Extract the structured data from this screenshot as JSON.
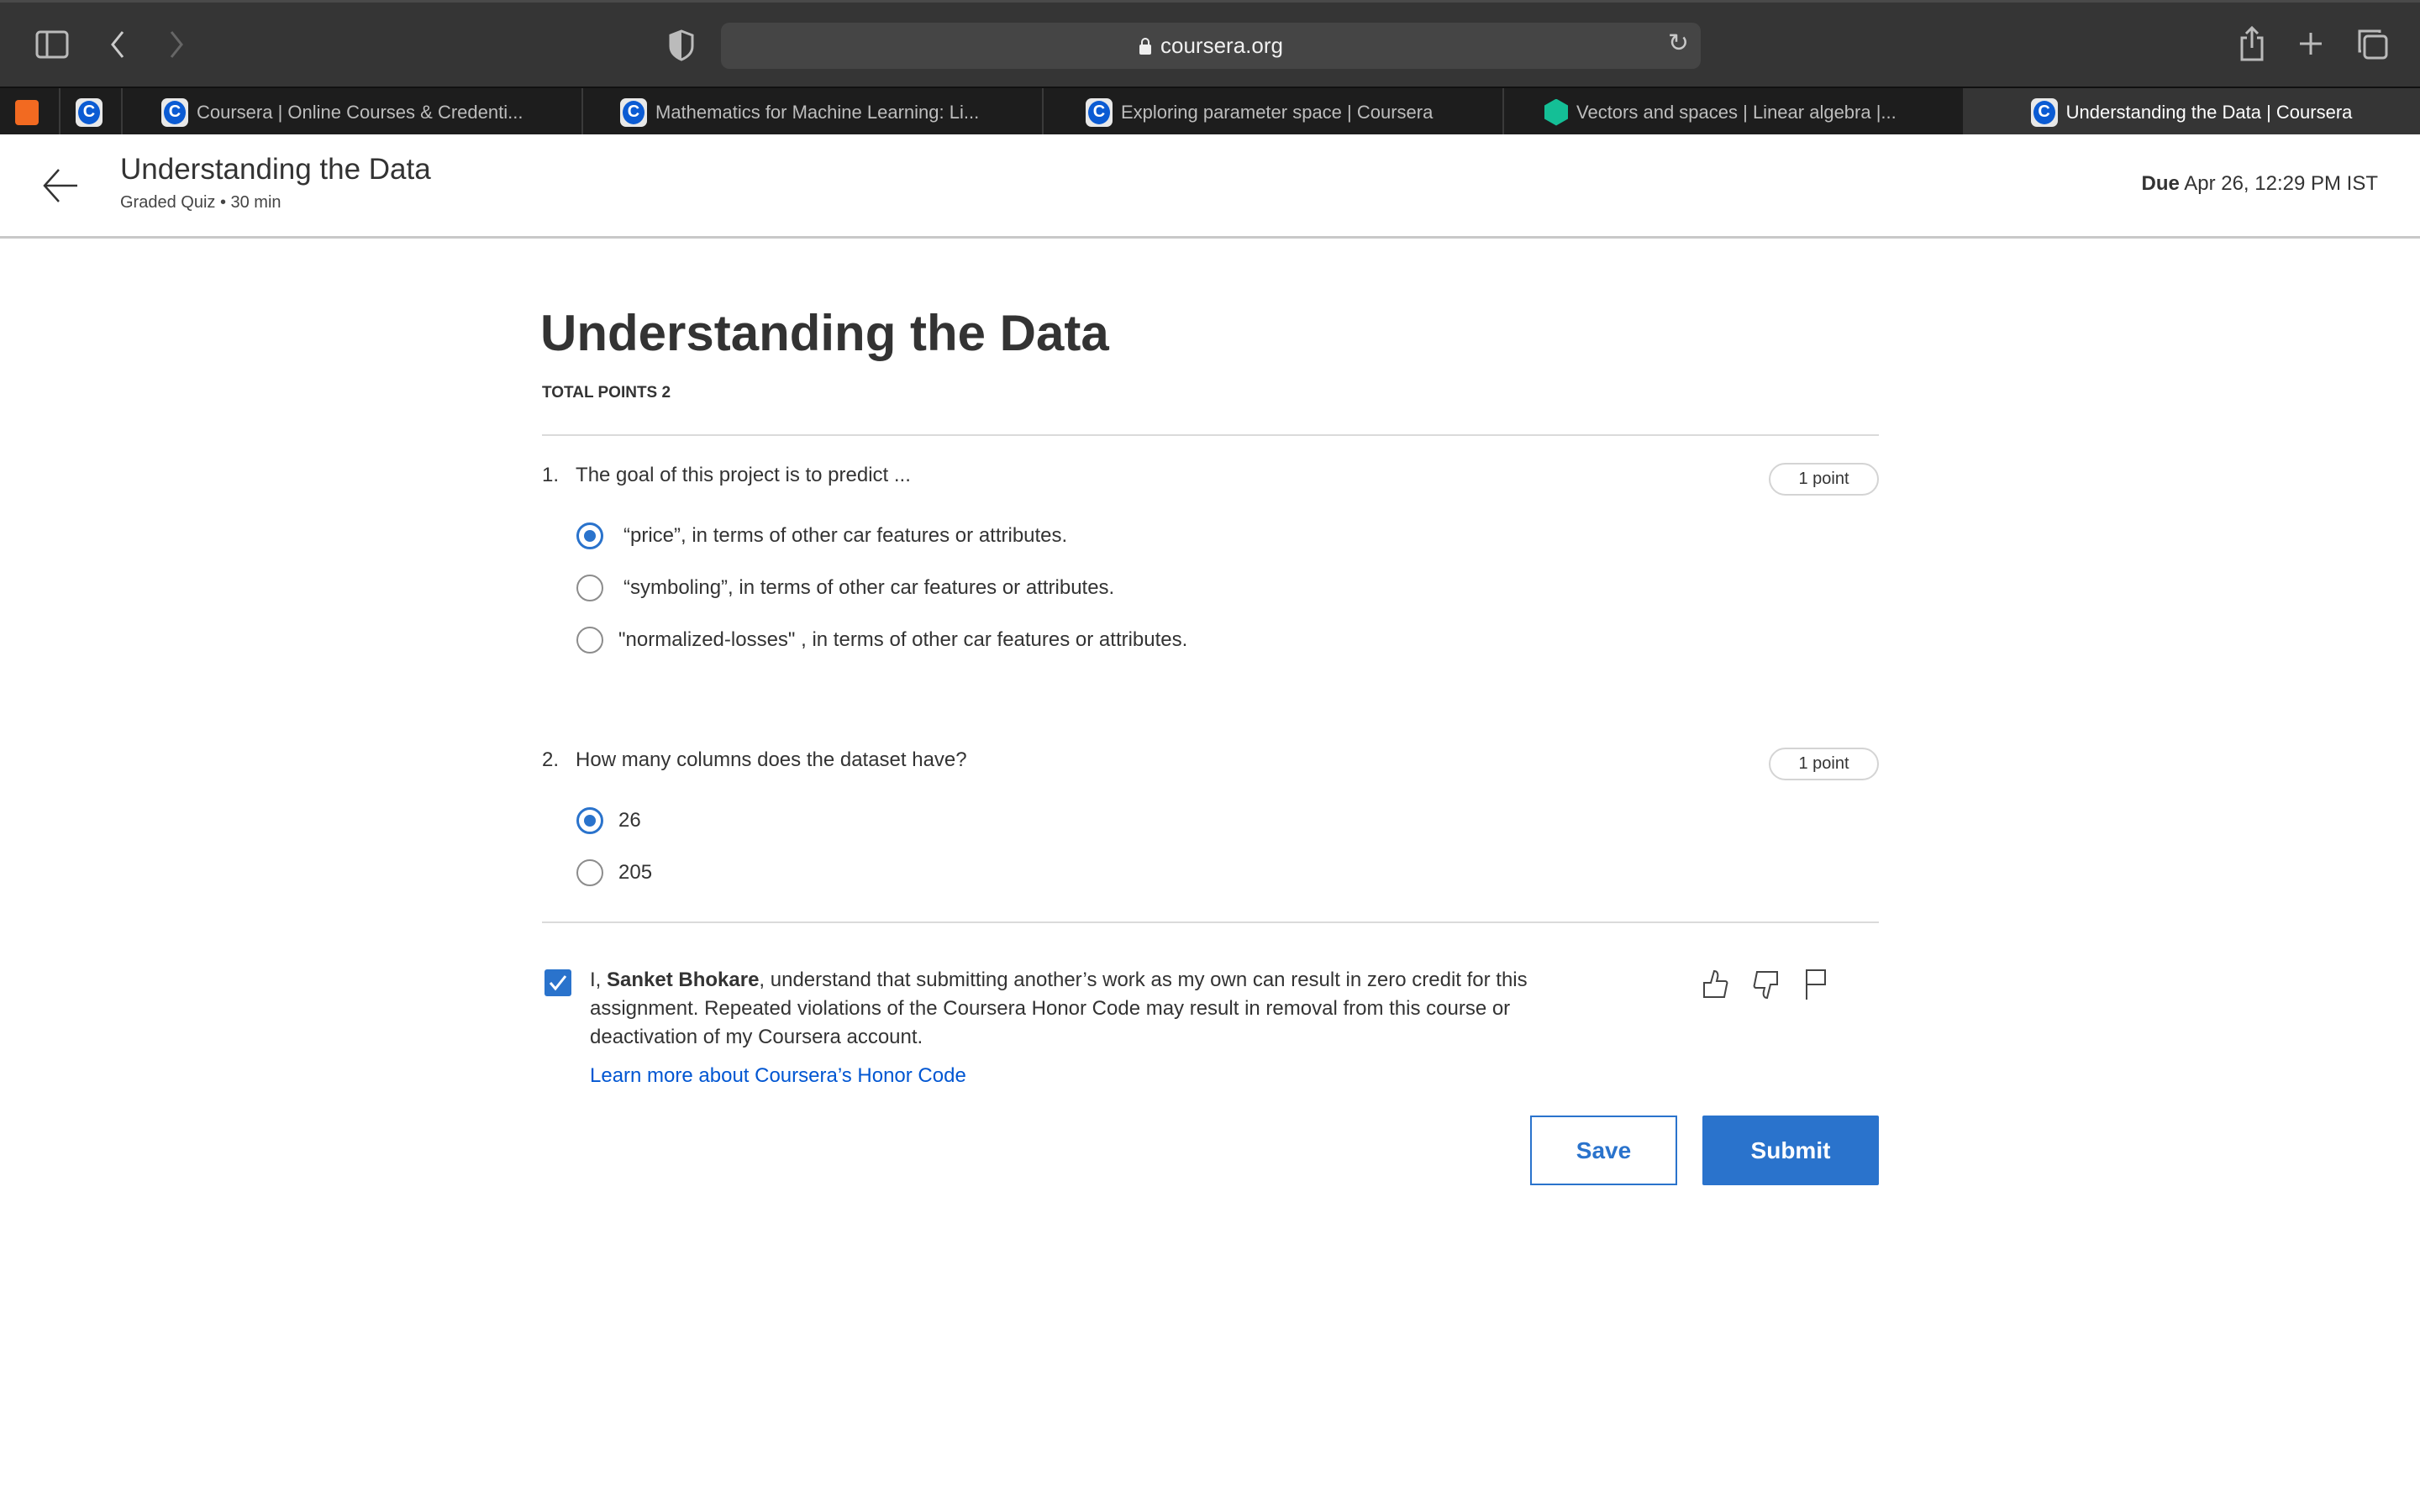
{
  "browser": {
    "url": "coursera.org",
    "tabs": [
      {
        "label": "",
        "icon": "brave-icon"
      },
      {
        "label": "",
        "icon": "coursera-icon"
      },
      {
        "label": "Coursera | Online Courses & Credenti...",
        "icon": "coursera-icon"
      },
      {
        "label": "Mathematics for Machine Learning: Li...",
        "icon": "coursera-icon"
      },
      {
        "label": "Exploring parameter space | Coursera",
        "icon": "coursera-icon"
      },
      {
        "label": "Vectors and spaces | Linear algebra |...",
        "icon": "khan-academy-icon"
      },
      {
        "label": "Understanding the Data | Coursera",
        "icon": "coursera-icon",
        "active": true
      }
    ]
  },
  "header": {
    "title": "Understanding the Data",
    "subtitle": "Graded Quiz • 30 min",
    "due_label": "Due",
    "due_value": "Apr 26, 12:29 PM IST"
  },
  "quiz": {
    "title": "Understanding the Data",
    "total_points": "TOTAL POINTS 2",
    "questions": [
      {
        "number": "1.",
        "text": "The goal of this project is to predict ...",
        "points": "1 point",
        "options": [
          {
            "label": "“price”, in terms of other car features or attributes.",
            "selected": true
          },
          {
            "label": "“symboling”, in terms of other car features or attributes.",
            "selected": false
          },
          {
            "label": "\"normalized-losses\" , in terms of other car features  or attributes.",
            "selected": false
          }
        ]
      },
      {
        "number": "2.",
        "text": "How many columns does the dataset have?",
        "points": "1 point",
        "options": [
          {
            "label": "26",
            "selected": true
          },
          {
            "label": "205",
            "selected": false
          }
        ]
      }
    ],
    "honor": {
      "checked": true,
      "prefix": "I, ",
      "name": "Sanket Bhokare",
      "text": ", understand that submitting another’s work as my own can result in zero credit for this assignment. Repeated violations of the Coursera Honor Code may result in removal from this course or deactivation of my Coursera account.",
      "link": "Learn more about Coursera’s Honor Code"
    },
    "save_label": "Save",
    "submit_label": "Submit"
  },
  "colors": {
    "accent": "#2a73cc",
    "link": "#0056d2"
  }
}
